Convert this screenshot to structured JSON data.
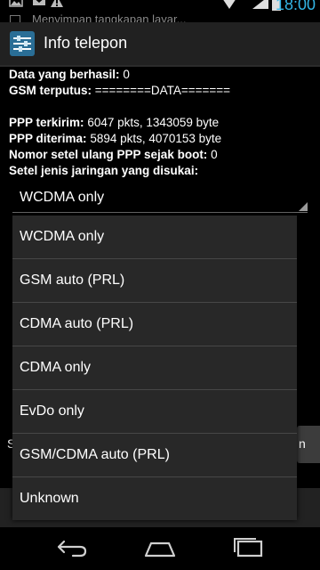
{
  "status_bar": {
    "time": "18:00",
    "notification_text": "Menyimpan tangkapan layar...",
    "icons": [
      "image-icon",
      "mail-icon",
      "warning-icon",
      "wifi-icon",
      "signal-icon",
      "battery-icon"
    ]
  },
  "action_bar": {
    "title": "Info telepon",
    "icon": "settings-sliders-icon"
  },
  "info": {
    "data_success_label": "Data yang berhasil:",
    "data_success_value": "0",
    "gsm_disconnect_label": "GSM terputus:",
    "gsm_disconnect_value": "========DATA=======",
    "ppp_sent_label": "PPP terkirim:",
    "ppp_sent_value": "6047 pkts, 1343059 byte",
    "ppp_received_label": "PPP diterima:",
    "ppp_received_value": "5894 pkts, 4070153 byte",
    "ppp_reset_label": "Nomor setel ulang PPP sejak boot:",
    "ppp_reset_value": "0",
    "network_type_label": "Setel jenis jaringan yang disukai:"
  },
  "spinner": {
    "selected": "WCDMA only"
  },
  "dropdown": {
    "options": [
      "WCDMA only",
      "GSM auto (PRL)",
      "CDMA auto (PRL)",
      "CDMA only",
      "EvDo only",
      "GSM/CDMA auto (PRL)",
      "Unknown"
    ]
  },
  "background": {
    "left_fragment": "S",
    "button_fragment": "n"
  },
  "colors": {
    "accent": "#33b5e5",
    "action_bar": "#212121",
    "dropdown_bg": "#282828",
    "divider": "#474747"
  },
  "nav_bar": {
    "icons": [
      "back-icon",
      "home-icon",
      "recents-icon"
    ]
  }
}
